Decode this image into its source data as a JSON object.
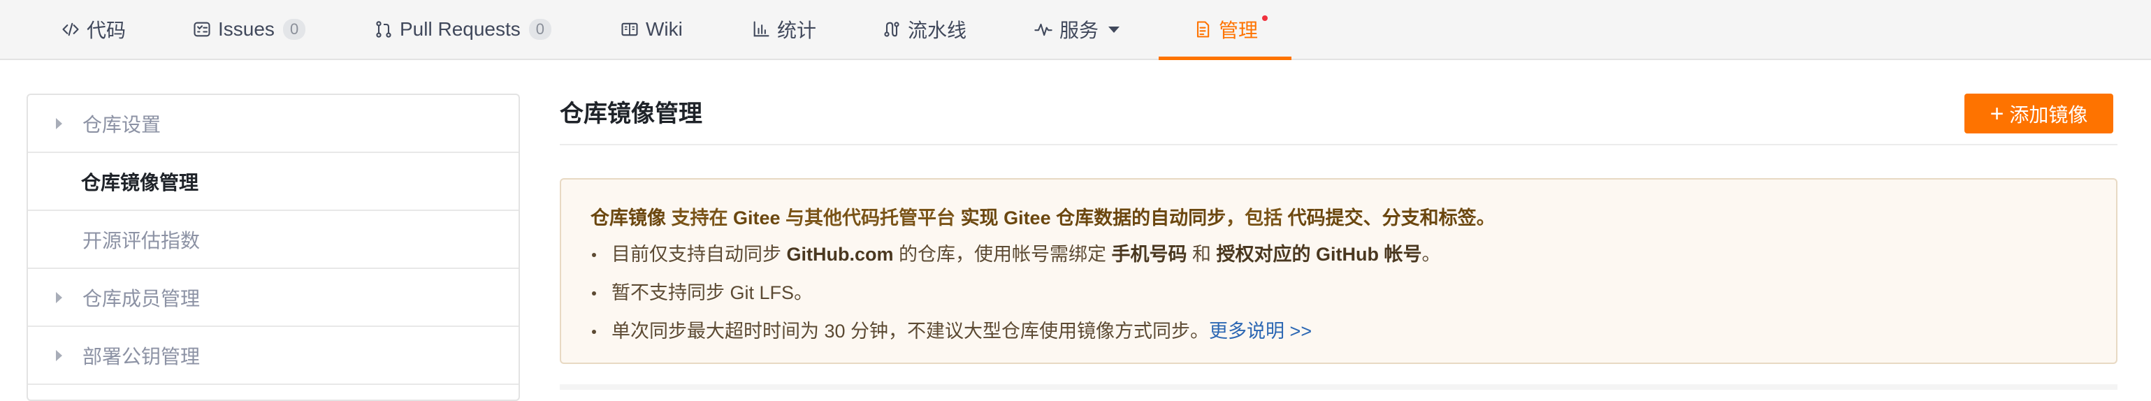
{
  "tabs": [
    {
      "label": "代码",
      "icon": "code-icon"
    },
    {
      "label": "Issues",
      "icon": "issues-icon",
      "count": "0"
    },
    {
      "label": "Pull Requests",
      "icon": "pull-request-icon",
      "count": "0"
    },
    {
      "label": "Wiki",
      "icon": "wiki-icon"
    },
    {
      "label": "统计",
      "icon": "stats-icon"
    },
    {
      "label": "流水线",
      "icon": "pipeline-icon"
    },
    {
      "label": "服务",
      "icon": "service-icon"
    },
    {
      "label": "管理",
      "icon": "manage-icon",
      "active": true
    }
  ],
  "sidebar": {
    "items": [
      {
        "label": "仓库设置",
        "expandable": true
      },
      {
        "label": "仓库镜像管理",
        "active": true
      },
      {
        "label": "开源评估指数"
      },
      {
        "label": "仓库成员管理",
        "expandable": true
      },
      {
        "label": "部署公钥管理",
        "expandable": true
      }
    ]
  },
  "main": {
    "title": "仓库镜像管理",
    "add_button": "添加镜像",
    "notice": {
      "lead": {
        "p1": "仓库镜像",
        "p2": " 支持在 ",
        "p3": "Gitee",
        "p4": " 与其他代码托管平台 ",
        "p5": "实现 Gitee 仓库数据的自动同步",
        "p6": "，包括 ",
        "p7": "代码提交、分支和标签",
        "p8": "。"
      },
      "line1": {
        "p1": "目前仅支持自动同步 ",
        "p2": "GitHub.com",
        "p3": " 的仓库，使用帐号需绑定 ",
        "p4": "手机号码",
        "p5": " 和 ",
        "p6": "授权对应的 GitHub 帐号",
        "p7": "。"
      },
      "line2": "暂不支持同步 Git LFS。",
      "line3": {
        "text": "单次同步最大超时时间为 30 分钟，不建议大型仓库使用镜像方式同步。",
        "link": "更多说明 >>"
      }
    }
  },
  "colors": {
    "accent": "#fe7300",
    "notice_bg": "#fdf8f2",
    "link": "#2c67b3"
  }
}
